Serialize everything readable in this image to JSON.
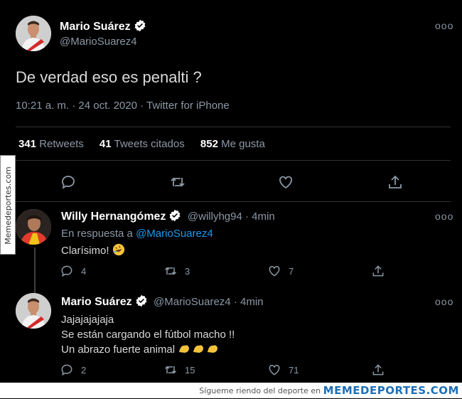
{
  "main_tweet": {
    "name": "Mario Suárez",
    "handle": "@MarioSuarez4",
    "text": "De verdad eso es penalti ?",
    "timestamp": "10:21 a. m. · 24 oct. 2020 · Twitter for iPhone",
    "stats": {
      "retweets_count": "341",
      "retweets_label": "Retweets",
      "quotes_count": "41",
      "quotes_label": "Tweets citados",
      "likes_count": "852",
      "likes_label": "Me gusta"
    },
    "more_icon": "ellipsis-icon"
  },
  "reply1": {
    "name": "Willy Hernangómez",
    "handle": "@willyhg94 · 4min",
    "in_reply_label": "En respuesta a",
    "in_reply_handle": "@MarioSuarez4",
    "text": "Clarísimo!",
    "emoji": "rolling-on-floor-laughing",
    "replies": "4",
    "retweets": "3",
    "likes": "7"
  },
  "reply2": {
    "name": "Mario Suárez",
    "handle": "@MarioSuarez4 · 4min",
    "line1": "Jajajajajaja",
    "line2": "Se están cargando el fútbol macho !!",
    "line3": "Un abrazo fuerte animal",
    "emoji": "flexed-biceps",
    "replies": "2",
    "retweets": "15",
    "likes": "71"
  },
  "watermark": {
    "side": "Memedeportes.com",
    "footer_text": "Sígueme riendo del deporte en",
    "footer_brand": "MEMEDEPORTES.COM"
  },
  "colors": {
    "background": "#000000",
    "accent": "#1d9bf0",
    "muted": "#8b98a5"
  }
}
